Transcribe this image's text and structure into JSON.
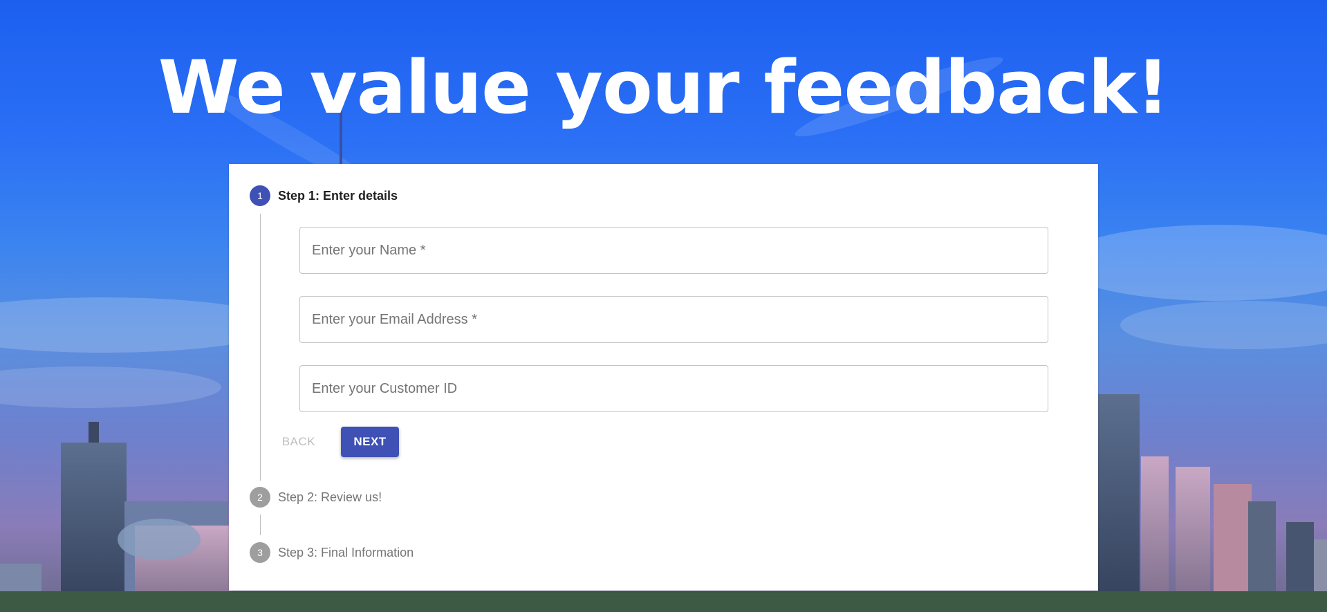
{
  "hero": {
    "title": "We value your feedback!"
  },
  "stepper": {
    "steps": [
      {
        "number": "1",
        "label": "Step 1: Enter details",
        "state": "active"
      },
      {
        "number": "2",
        "label": "Step 2: Review us!",
        "state": "inactive"
      },
      {
        "number": "3",
        "label": "Step 3: Final Information",
        "state": "inactive"
      }
    ]
  },
  "form": {
    "name_label": "Enter your Name *",
    "email_label": "Enter your Email Address *",
    "customer_id_label": "Enter your Customer ID"
  },
  "actions": {
    "back_label": "BACK",
    "next_label": "NEXT"
  },
  "colors": {
    "primary": "#3f51b5",
    "inactive_step": "#9e9e9e",
    "sky": "#1c5ff0"
  }
}
